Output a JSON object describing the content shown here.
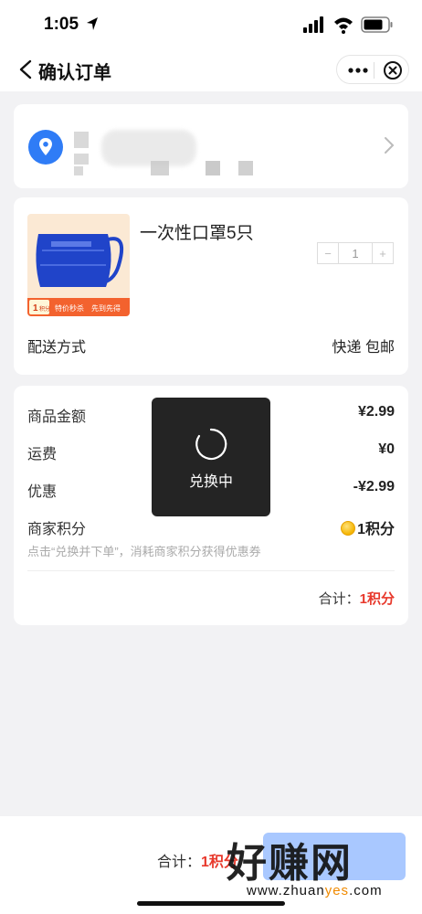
{
  "status_bar": {
    "time": "1:05"
  },
  "nav": {
    "title": "确认订单"
  },
  "address": {
    "icon": "location-pin-icon",
    "accent": "#2f7cf6"
  },
  "product": {
    "title": "一次性口罩5只",
    "quantity": "1",
    "stepper_minus": "−",
    "stepper_plus": "+",
    "image_badge_points": "1",
    "image_badge_unit": "积分",
    "image_badge_tag1": "特价秒杀",
    "image_badge_tag2": "先到先得"
  },
  "delivery": {
    "label": "配送方式",
    "value": "快递 包邮"
  },
  "summary": {
    "rows": [
      {
        "label": "商品金额",
        "value": "¥2.99"
      },
      {
        "label": "运费",
        "value": "¥0"
      },
      {
        "label": "优惠",
        "value": "-¥2.99"
      },
      {
        "label": "商家积分",
        "value": "1积分"
      }
    ],
    "hint": "点击“兑换并下单”，消耗商家积分获得优惠券",
    "total_label": "合计：",
    "total_value": "1积分"
  },
  "toast": {
    "text": "兑换中"
  },
  "bottom": {
    "total_label": "合计：",
    "total_value": "1积分"
  },
  "watermark": {
    "main": "好赚网",
    "sub_prefix": "www.zhuan",
    "sub_highlight": "yes",
    "sub_suffix": ".com"
  },
  "colors": {
    "accent_red": "#e8392c",
    "button_blue": "#a9c8ff",
    "location_blue": "#2f7cf6"
  }
}
